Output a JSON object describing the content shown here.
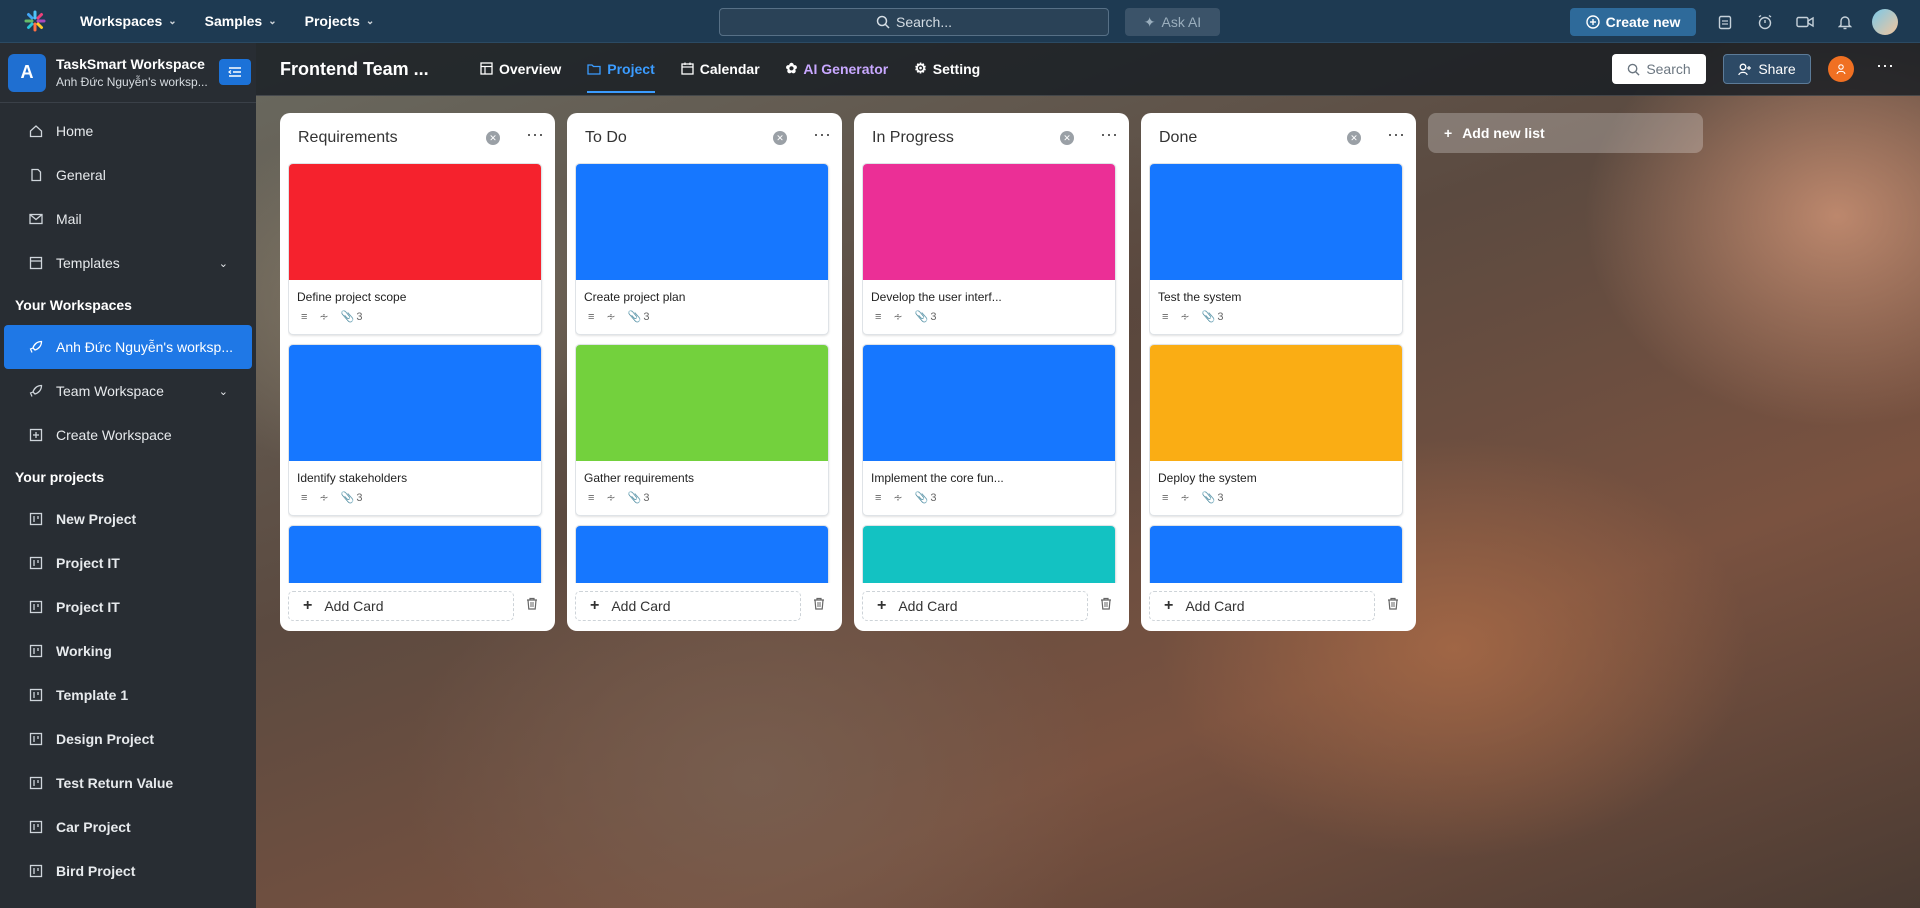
{
  "topbar": {
    "nav": [
      {
        "label": "Workspaces"
      },
      {
        "label": "Samples"
      },
      {
        "label": "Projects"
      }
    ],
    "search_placeholder": "Search...",
    "ask_ai": "Ask AI",
    "create_new": "Create new"
  },
  "sidebar": {
    "workspace_title": "TaskSmart Workspace",
    "workspace_sub": "Anh Đức Nguyễn's worksp...",
    "workspace_initial": "A",
    "items": [
      {
        "label": "Home"
      },
      {
        "label": "General"
      },
      {
        "label": "Mail"
      },
      {
        "label": "Templates"
      }
    ],
    "your_workspaces_heading": "Your Workspaces",
    "workspaces": [
      {
        "label": "Anh Đức Nguyễn's worksp..."
      },
      {
        "label": "Team Workspace"
      },
      {
        "label": "Create Workspace"
      }
    ],
    "your_projects_heading": "Your projects",
    "projects": [
      {
        "label": "New Project"
      },
      {
        "label": "Project IT"
      },
      {
        "label": "Project IT"
      },
      {
        "label": "Working"
      },
      {
        "label": "Template 1"
      },
      {
        "label": "Design Project"
      },
      {
        "label": "Test Return Value"
      },
      {
        "label": "Car Project"
      },
      {
        "label": "Bird Project"
      }
    ]
  },
  "board": {
    "title": "Frontend Team ...",
    "tabs": [
      {
        "label": "Overview"
      },
      {
        "label": "Project"
      },
      {
        "label": "Calendar"
      },
      {
        "label": "AI Generator"
      },
      {
        "label": "Setting"
      }
    ],
    "search": "Search",
    "share": "Share",
    "add_new_list": "Add new list",
    "add_card": "Add Card",
    "lists": [
      {
        "title": "Requirements",
        "cards": [
          {
            "title": "Define project scope",
            "color": "#f5222d",
            "attachments": "3"
          },
          {
            "title": "Identify stakeholders",
            "color": "#1677ff",
            "attachments": "3"
          },
          {
            "title": "",
            "color": "#1677ff",
            "attachments": ""
          }
        ]
      },
      {
        "title": "To Do",
        "cards": [
          {
            "title": "Create project plan",
            "color": "#1677ff",
            "attachments": "3"
          },
          {
            "title": "Gather requirements",
            "color": "#73d13d",
            "attachments": "3"
          },
          {
            "title": "",
            "color": "#1677ff",
            "attachments": ""
          }
        ]
      },
      {
        "title": "In Progress",
        "cards": [
          {
            "title": "Develop the user interf...",
            "color": "#eb2f96",
            "attachments": "3"
          },
          {
            "title": "Implement the core fun...",
            "color": "#1677ff",
            "attachments": "3"
          },
          {
            "title": "",
            "color": "#13c2c2",
            "attachments": ""
          }
        ]
      },
      {
        "title": "Done",
        "cards": [
          {
            "title": "Test the system",
            "color": "#1677ff",
            "attachments": "3"
          },
          {
            "title": "Deploy the system",
            "color": "#faad14",
            "attachments": "3"
          },
          {
            "title": "",
            "color": "#1677ff",
            "attachments": ""
          }
        ]
      }
    ]
  }
}
